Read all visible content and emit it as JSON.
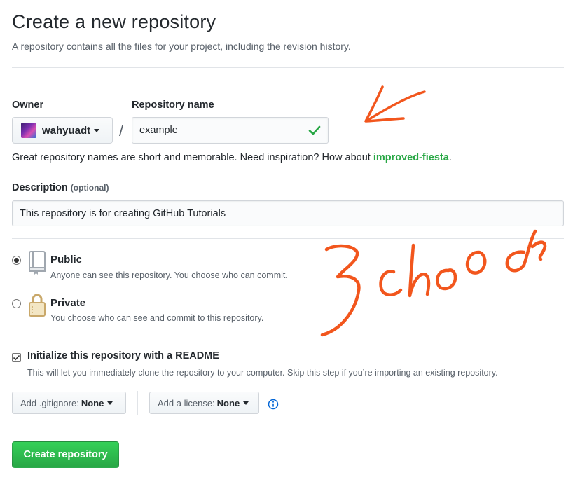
{
  "header": {
    "title": "Create a new repository",
    "subtitle": "A repository contains all the files for your project, including the revision history."
  },
  "owner": {
    "label": "Owner",
    "value": "wahyuadt",
    "avatar_icon": "user-avatar"
  },
  "separator": "/",
  "repository": {
    "label": "Repository name",
    "value": "example",
    "valid_icon": "check-icon",
    "valid_color": "#28a745"
  },
  "hint": {
    "text": "Great repository names are short and memorable. Need inspiration? How about ",
    "suggestion": "improved-fiesta",
    "end": "."
  },
  "description": {
    "label": "Description",
    "optional": "(optional)",
    "value": "This repository is for creating GitHub Tutorials"
  },
  "visibility": {
    "selected": "public",
    "public": {
      "title": "Public",
      "note": "Anyone can see this repository. You choose who can commit.",
      "icon": "repo-book-icon"
    },
    "private": {
      "title": "Private",
      "note": "You choose who can see and commit to this repository.",
      "icon": "lock-icon"
    }
  },
  "readme": {
    "checked": true,
    "title": "Initialize this repository with a README",
    "note": "This will let you immediately clone the repository to your computer. Skip this step if you’re importing an existing repository."
  },
  "gitignore": {
    "prefix": "Add .gitignore:",
    "value": "None"
  },
  "license": {
    "prefix": "Add a license:",
    "value": "None"
  },
  "info_icon": "info-icon",
  "submit": {
    "label": "Create repository",
    "color": "#28a745"
  },
  "annotation": {
    "text": "choose",
    "color": "#f2561d",
    "arrow_icon": "handdrawn-arrow"
  }
}
